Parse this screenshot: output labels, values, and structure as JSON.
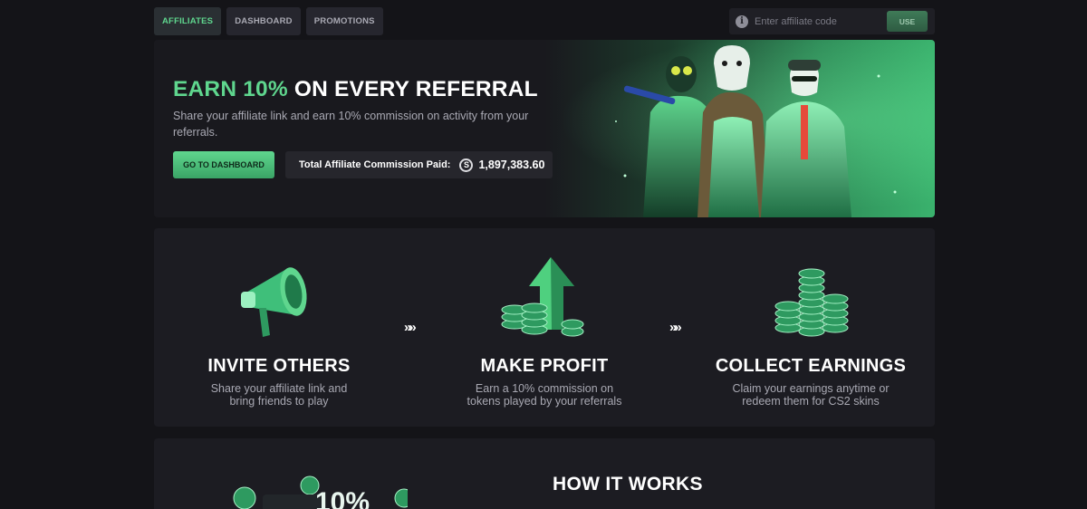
{
  "nav": {
    "tabs": [
      {
        "label": "AFFILIATES",
        "active": true
      },
      {
        "label": "DASHBOARD",
        "active": false
      },
      {
        "label": "PROMOTIONS",
        "active": false
      }
    ],
    "code": {
      "placeholder": "Enter affiliate code",
      "button": "USE",
      "icon": "i"
    }
  },
  "hero": {
    "title_accent": "EARN 10%",
    "title_rest": " ON EVERY REFERRAL",
    "subtitle": "Share your affiliate link and earn 10% commission on activity from your referrals.",
    "cta": "GO TO DASHBOARD",
    "commission_label": "Total Affiliate Commission Paid:",
    "coin_symbol": "S",
    "commission_value": "1,897,383.60"
  },
  "steps": [
    {
      "title": "INVITE OTHERS",
      "desc": "Share your affiliate link and bring friends to play",
      "icon": "megaphone-icon"
    },
    {
      "title": "MAKE PROFIT",
      "desc": "Earn a 10% commission on tokens played by your referrals",
      "icon": "coins-arrow-icon"
    },
    {
      "title": "COLLECT EARNINGS",
      "desc": "Claim your earnings anytime or redeem them for CS2 skins",
      "icon": "coin-pile-icon"
    }
  ],
  "separator": "»»",
  "how": {
    "title": "HOW IT WORKS",
    "badge": "10%"
  },
  "colors": {
    "accent": "#5fd68e",
    "background": "#141418",
    "panel": "#1c1c22"
  }
}
